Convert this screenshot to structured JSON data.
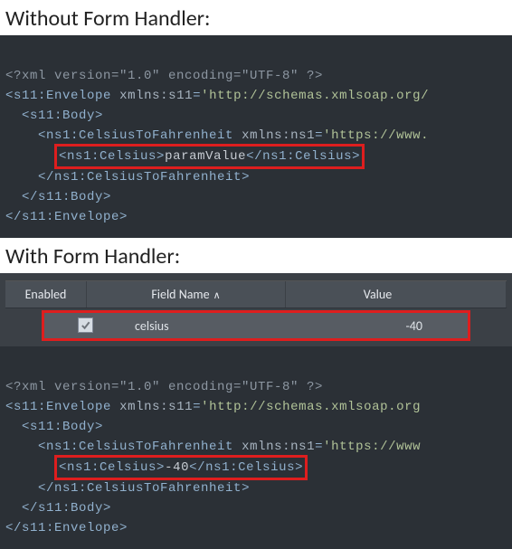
{
  "sections": {
    "without": {
      "title": "Without Form Handler:"
    },
    "with": {
      "title": "With Form Handler:"
    }
  },
  "xml_without": {
    "line1": "<?xml version=\"1.0\" encoding=\"UTF-8\" ?>",
    "env_open_name": "s11:Envelope",
    "env_attr_name": "xmlns:s11",
    "env_attr_val": "'http://schemas.xmlsoap.org/",
    "body_open": "s11:Body",
    "op_open_name": "ns1:CelsiusToFahrenheit",
    "op_attr_name": "xmlns:ns1",
    "op_attr_val": "'https://www.",
    "param_open": "ns1:Celsius",
    "param_text": "paramValue",
    "param_close": "ns1:Celsius",
    "op_close": "ns1:CelsiusToFahrenheit",
    "body_close": "s11:Body",
    "env_close": "s11:Envelope"
  },
  "table": {
    "headers": {
      "enabled": "Enabled",
      "field": "Field Name",
      "value": "Value",
      "sort_indicator": "∧"
    },
    "row": {
      "enabled": true,
      "field": "celsius",
      "value": "-40"
    }
  },
  "xml_with": {
    "line1": "<?xml version=\"1.0\" encoding=\"UTF-8\" ?>",
    "env_open_name": "s11:Envelope",
    "env_attr_name": "xmlns:s11",
    "env_attr_val": "'http://schemas.xmlsoap.org",
    "body_open": "s11:Body",
    "op_open_name": "ns1:CelsiusToFahrenheit",
    "op_attr_name": "xmlns:ns1",
    "op_attr_val": "'https://www",
    "param_open": "ns1:Celsius",
    "param_text": "-40",
    "param_close": "ns1:Celsius",
    "op_close": "ns1:CelsiusToFahrenheit",
    "body_close": "s11:Body",
    "env_close": "s11:Envelope"
  }
}
